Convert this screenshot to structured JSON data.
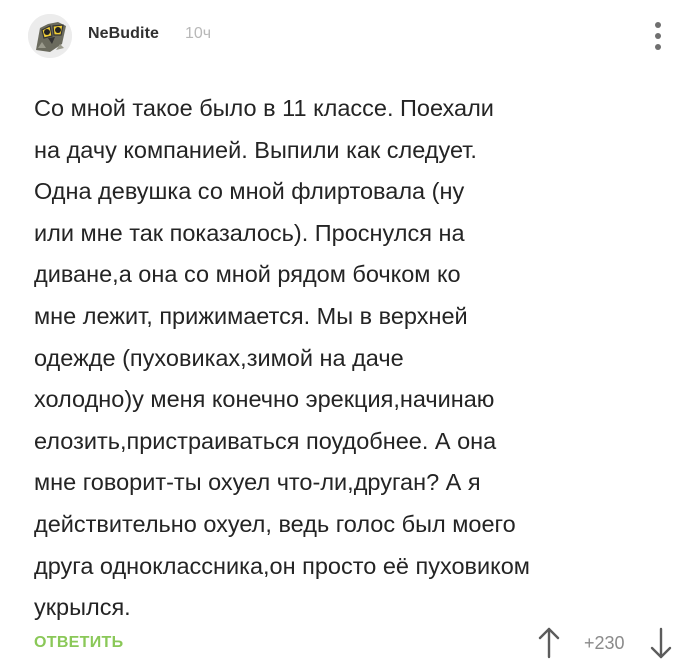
{
  "comment": {
    "author": "NeBudite",
    "time": "10ч",
    "avatar_icon": "owl-avatar-icon",
    "menu_icon": "vertical-dots-icon",
    "lines": [
      "Со мной такое было в 11 классе. Поехали",
      "на дачу компанией. Выпили как следует.",
      "Одна девушка со мной флиртовала (ну",
      "или мне так показалось). Проснулся на",
      "диване,а она со мной рядом бочком ко",
      "мне лежит, прижимается. Мы в верхней",
      "одежде (пуховиках,зимой на даче",
      "холодно)у меня конечно эрекция,начинаю",
      "елозить,пристраиваться поудобнее. А она",
      "мне говорит-ты охуел что-ли,друган? А я",
      "действительно охуел, ведь голос был моего",
      "друга одноклассника,он просто её пуховиком",
      "укрылся."
    ]
  },
  "footer": {
    "reply_label": "ОТВЕТИТЬ",
    "rating": "+230",
    "vote_up_icon": "arrow-up-icon",
    "vote_down_icon": "arrow-down-icon"
  },
  "colors": {
    "accent_green": "#8ac858",
    "text": "#242424",
    "muted": "#b8b8b8"
  }
}
